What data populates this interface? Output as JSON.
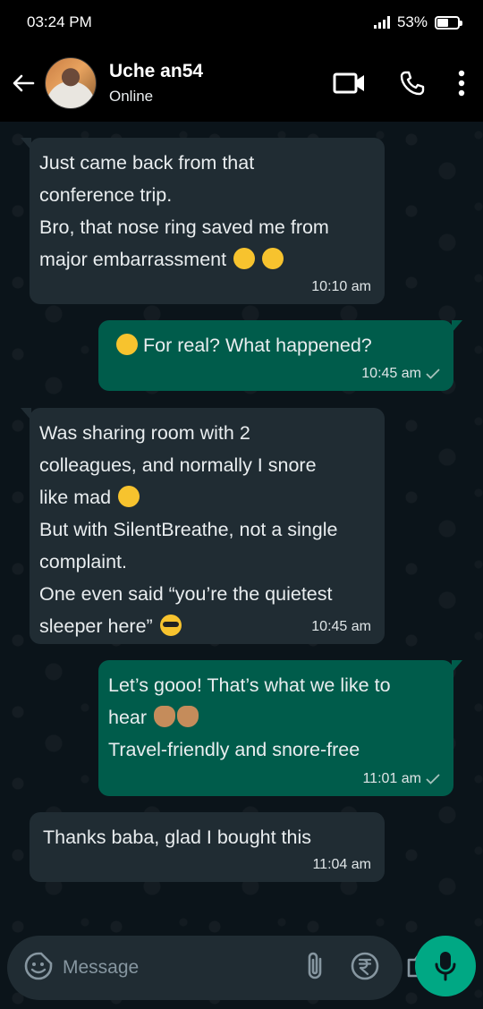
{
  "status_bar": {
    "time": "03:24 PM",
    "battery": "53%",
    "battery_level": 0.53
  },
  "header": {
    "name": "Uche an54",
    "status": "Online"
  },
  "messages": [
    {
      "direction": "in",
      "text": "Just came back from that\nconference trip.\nBro, that nose ring saved me from\nmajor embarrassment",
      "emojis": [
        "crying-face",
        "grinning-sweat-face"
      ],
      "time": "10:10 am"
    },
    {
      "direction": "out",
      "text": "For real? What happened?",
      "emojis": [
        "grinning-sweat-face"
      ],
      "time": "10:45 am"
    },
    {
      "direction": "in",
      "text": "Was sharing room with 2\ncolleagues, and normally I snore\nlike mad",
      "text2": "But with SilentBreathe, not a single\ncomplaint.\nOne even said “you’re the quietest\nsleeper here”",
      "emojis": [
        "tired-face",
        "sunglasses-face"
      ],
      "time": "10:45 am"
    },
    {
      "direction": "out",
      "text": "Let’s gooo! That’s what we like to\nhear",
      "text2": "Travel-friendly and snore-free",
      "emojis": [
        "clapping-hands",
        "clapping-hands"
      ],
      "time": "11:01 am"
    },
    {
      "direction": "in",
      "text": "Thanks baba, glad I bought this",
      "time": "11:04 am"
    }
  ],
  "input": {
    "placeholder": "Message"
  },
  "colors": {
    "incoming": "#202c33",
    "outgoing": "#005c4b",
    "accent": "#00a884"
  }
}
